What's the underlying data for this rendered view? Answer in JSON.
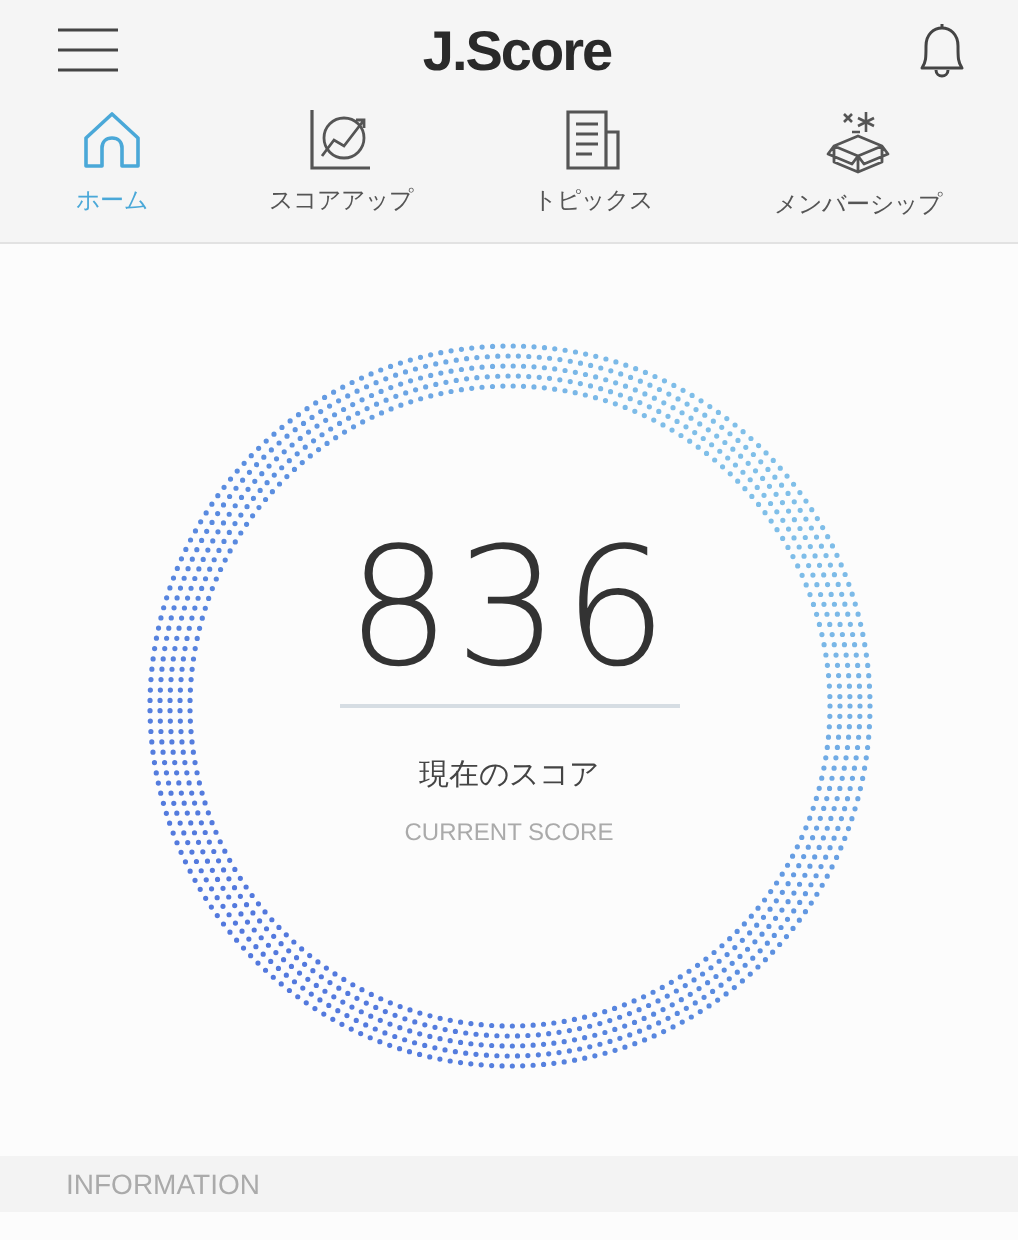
{
  "header": {
    "title": "J.Score"
  },
  "tabs": [
    {
      "label": "ホーム",
      "kind": "home",
      "selected": true
    },
    {
      "label": "スコアアップ",
      "kind": "chart",
      "selected": false
    },
    {
      "label": "トピックス",
      "kind": "news",
      "selected": false
    },
    {
      "label": "メンバーシップ",
      "kind": "gift",
      "selected": false
    }
  ],
  "score": {
    "value": "836",
    "label": "現在のスコア",
    "sublabel": "CURRENT SCORE"
  },
  "section": {
    "title": "INFORMATION"
  }
}
